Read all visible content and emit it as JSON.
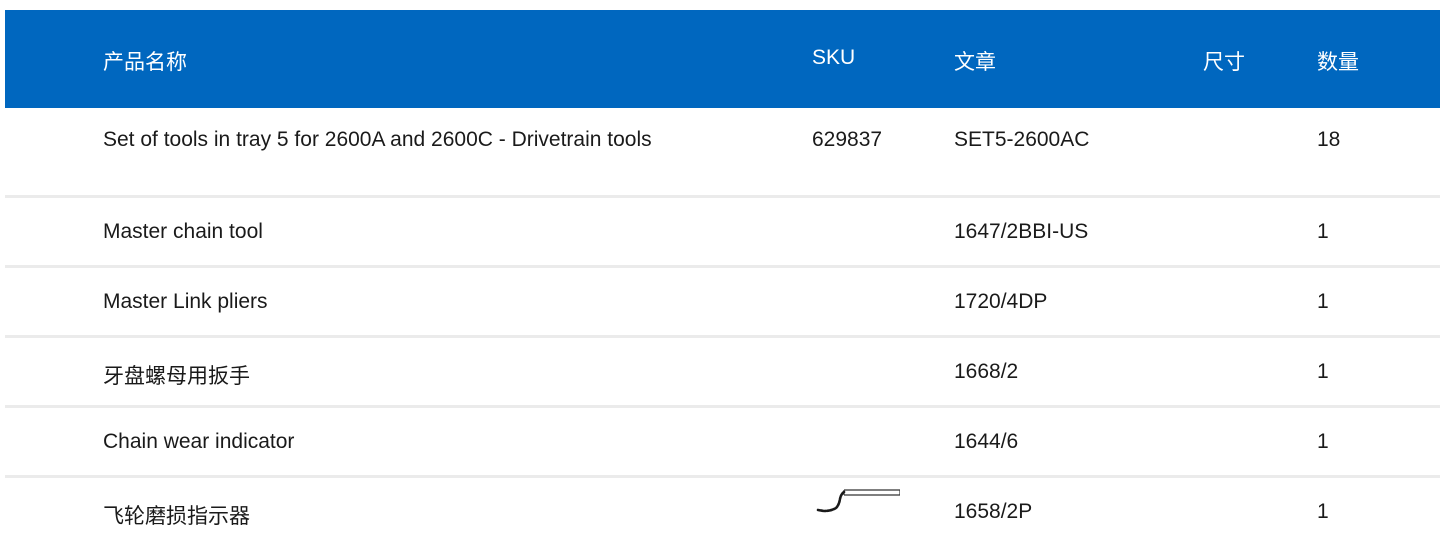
{
  "columns": {
    "name": "产品名称",
    "sku": "SKU",
    "article": "文章",
    "size": "尺寸",
    "quantity": "数量"
  },
  "rows": [
    {
      "name": "Set of tools in tray 5 for 2600A and 2600C - Drivetrain tools",
      "sku": "629837",
      "article": "SET5-2600AC",
      "size": "",
      "quantity": "18"
    },
    {
      "name": "Master chain tool",
      "sku": "",
      "article": "1647/2BBI-US",
      "size": "",
      "quantity": "1"
    },
    {
      "name": "Master Link pliers",
      "sku": "",
      "article": "1720/4DP",
      "size": "",
      "quantity": "1"
    },
    {
      "name": "牙盘螺母用扳手",
      "sku": "",
      "article": "1668/2",
      "size": "",
      "quantity": "1"
    },
    {
      "name": "Chain wear indicator",
      "sku": "",
      "article": "1644/6",
      "size": "",
      "quantity": "1"
    },
    {
      "name": "飞轮磨损指示器",
      "sku": "",
      "article": "1658/2P",
      "size": "",
      "quantity": "1"
    }
  ],
  "icons": {
    "row_6_thumbnail": "chain-whip-tool-icon"
  },
  "colors": {
    "header_background": "#0067bf",
    "header_text": "#ffffff",
    "row_divider": "#ebebeb"
  }
}
